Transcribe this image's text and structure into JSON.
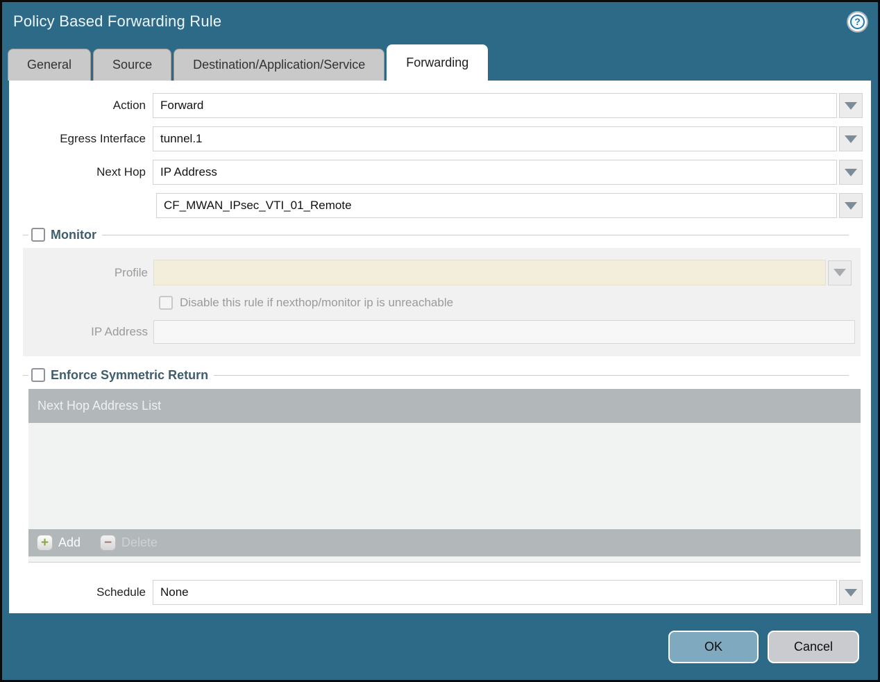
{
  "dialog": {
    "title": "Policy Based Forwarding Rule"
  },
  "tabs": [
    {
      "label": "General",
      "active": false
    },
    {
      "label": "Source",
      "active": false
    },
    {
      "label": "Destination/Application/Service",
      "active": false
    },
    {
      "label": "Forwarding",
      "active": true
    }
  ],
  "form": {
    "action": {
      "label": "Action",
      "value": "Forward"
    },
    "egress_interface": {
      "label": "Egress Interface",
      "value": "tunnel.1"
    },
    "next_hop": {
      "label": "Next Hop",
      "value": "IP Address",
      "address_value": "CF_MWAN_IPsec_VTI_01_Remote"
    },
    "schedule": {
      "label": "Schedule",
      "value": "None"
    }
  },
  "monitor": {
    "label": "Monitor",
    "checked": false,
    "profile_label": "Profile",
    "profile_value": "",
    "disable_rule_label": "Disable this rule if nexthop/monitor ip is unreachable",
    "disable_rule_checked": false,
    "ip_address_label": "IP Address",
    "ip_address_value": ""
  },
  "symmetric_return": {
    "label": "Enforce Symmetric Return",
    "checked": false,
    "table_header": "Next Hop Address List",
    "rows": [],
    "add_label": "Add",
    "delete_label": "Delete"
  },
  "footer": {
    "ok_label": "OK",
    "cancel_label": "Cancel"
  },
  "icons": {
    "help": "help-icon",
    "dropdown": "chevron-down-icon",
    "add": "plus-icon",
    "delete": "minus-icon"
  },
  "colors": {
    "titlebar_teal": "#2d6a88",
    "section_label": "#3f5d6d",
    "disabled_field_beige": "#f3eedb",
    "table_gray": "#b2b7ba",
    "ok_button": "#7ea9be",
    "cancel_button": "#c9cbce"
  }
}
